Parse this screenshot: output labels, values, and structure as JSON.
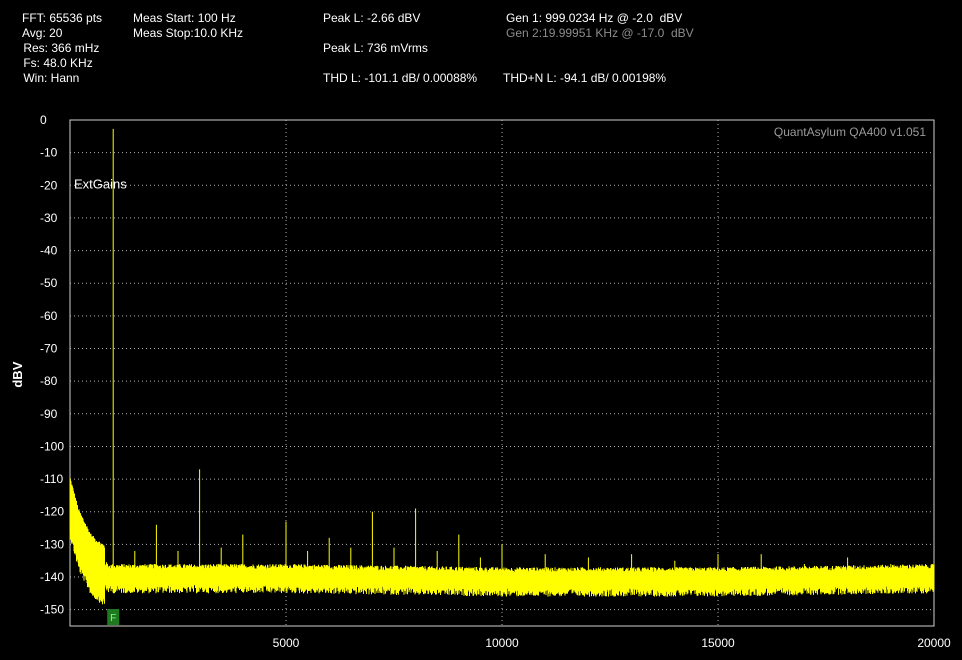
{
  "header": {
    "fft": "FFT: 65536 pts",
    "avg": "Avg: 20",
    "res": " Res: 366 mHz",
    "fs": " Fs: 48.0 KHz",
    "win": " Win: Hann",
    "meas_start": "Meas Start: 100 Hz",
    "meas_stop": "Meas Stop:10.0 KHz",
    "peak_l_dbv": "Peak L: -2.66 dBV",
    "peak_l_vrms": "Peak L: 736 mVrms",
    "thd_l": "THD L: -101.1 dB/ 0.00088%",
    "thdn_l": "THD+N L: -94.1 dB/ 0.00198%",
    "gen1": "Gen 1: 999.0234 Hz @ -2.0  dBV",
    "gen2": "Gen 2:19.99951 KHz @ -17.0  dBV"
  },
  "colors": {
    "trace": "#ffff00",
    "grid": "#b0b0b0",
    "marker": "#1f7a1f",
    "background": "#000000"
  },
  "chart_data": {
    "type": "line",
    "title": "",
    "xlabel": "",
    "ylabel": "dBV",
    "watermark": "QuantAsylum QA400 v1.051",
    "annotation": "ExtGains",
    "marker_label": "F",
    "marker_x": 1000,
    "xlim": [
      0,
      20000
    ],
    "ylim": [
      -155,
      0
    ],
    "xticks": [
      5000,
      10000,
      15000,
      20000
    ],
    "yticks": [
      0,
      -10,
      -20,
      -30,
      -40,
      -50,
      -60,
      -70,
      -80,
      -90,
      -100,
      -110,
      -120,
      -130,
      -140,
      -150
    ],
    "grid": true,
    "noise_floor": [
      [
        0,
        -118
      ],
      [
        200,
        -128
      ],
      [
        500,
        -136
      ],
      [
        900,
        -140
      ],
      [
        2000,
        -140
      ],
      [
        5000,
        -140
      ],
      [
        10000,
        -141
      ],
      [
        15000,
        -141
      ],
      [
        20000,
        -140
      ]
    ],
    "series": [
      {
        "values": [
          [
            1000,
            -2.7
          ],
          [
            2000,
            -124
          ],
          [
            3000,
            -107
          ],
          [
            4000,
            -127
          ],
          [
            5000,
            -123
          ],
          [
            6000,
            -128
          ],
          [
            7000,
            -120
          ],
          [
            8000,
            -119
          ],
          [
            9000,
            -127
          ],
          [
            10000,
            -130
          ],
          [
            11000,
            -133
          ],
          [
            12000,
            -134
          ],
          [
            13000,
            -133
          ],
          [
            14000,
            -135
          ],
          [
            15000,
            -133
          ],
          [
            16000,
            -133
          ],
          [
            17000,
            -136
          ],
          [
            18000,
            -134
          ],
          [
            19000,
            -136
          ],
          [
            2500,
            -132
          ],
          [
            3500,
            -131
          ],
          [
            5500,
            -132
          ],
          [
            6500,
            -131
          ],
          [
            7500,
            -131
          ],
          [
            8500,
            -132
          ],
          [
            9500,
            -134
          ],
          [
            1500,
            -132
          ]
        ]
      }
    ]
  }
}
